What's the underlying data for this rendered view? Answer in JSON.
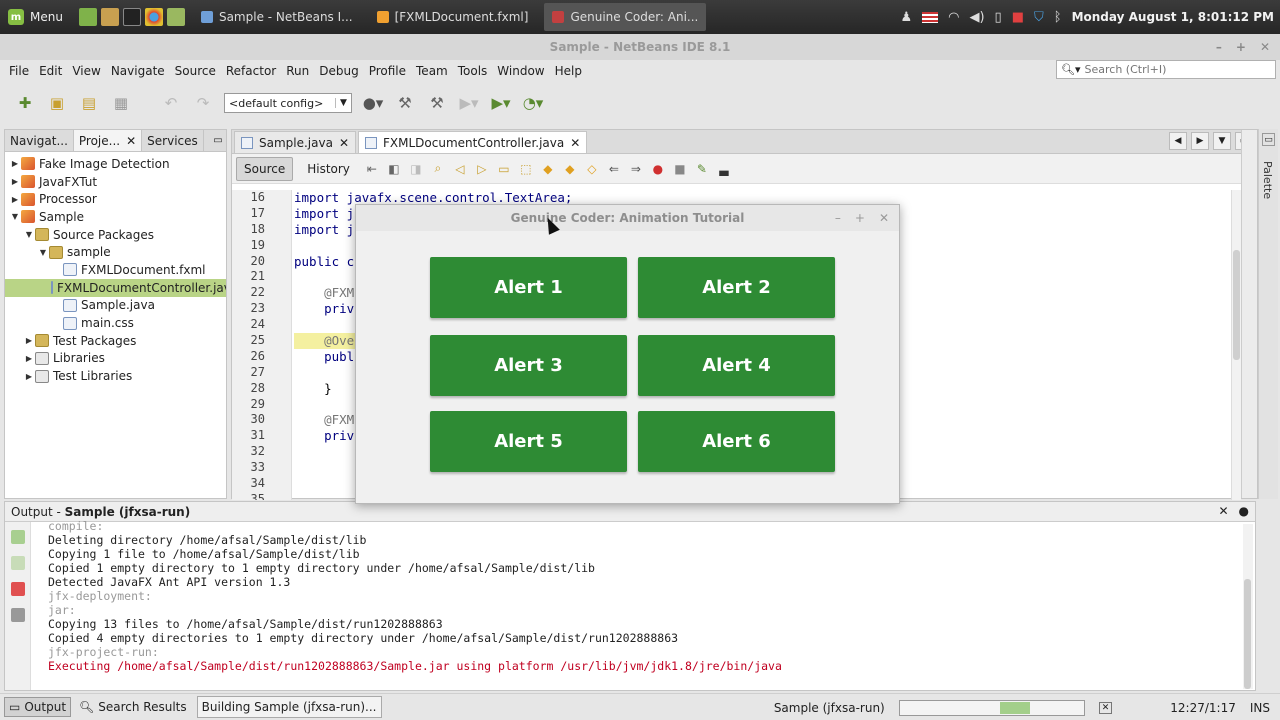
{
  "panel": {
    "menu_label": "Menu",
    "tasks": [
      {
        "label": "Sample - NetBeans I...",
        "color": "#6f9fd8"
      },
      {
        "label": "[FXMLDocument.fxml]",
        "color": "#f0a030"
      },
      {
        "label": "Genuine Coder: Ani...",
        "color": "#c24040"
      }
    ],
    "clock": "Monday August  1,  8:01:12 PM"
  },
  "ide": {
    "title": "Sample - NetBeans IDE 8.1",
    "menus": [
      "File",
      "Edit",
      "View",
      "Navigate",
      "Source",
      "Refactor",
      "Run",
      "Debug",
      "Profile",
      "Team",
      "Tools",
      "Window",
      "Help"
    ],
    "search_placeholder": "Search (Ctrl+I)",
    "config_value": "<default config>"
  },
  "left_panel": {
    "tabs": [
      "Navigat...",
      "Proje...",
      "Services"
    ],
    "tree": [
      {
        "label": "Fake Image Detection",
        "depth": 0,
        "arrow": "▶",
        "icon": "proj"
      },
      {
        "label": "JavaFXTut",
        "depth": 0,
        "arrow": "▶",
        "icon": "proj"
      },
      {
        "label": "Processor",
        "depth": 0,
        "arrow": "▶",
        "icon": "proj"
      },
      {
        "label": "Sample",
        "depth": 0,
        "arrow": "▼",
        "icon": "proj"
      },
      {
        "label": "Source Packages",
        "depth": 1,
        "arrow": "▼",
        "icon": "pkg"
      },
      {
        "label": "sample",
        "depth": 2,
        "arrow": "▼",
        "icon": "pkg"
      },
      {
        "label": "FXMLDocument.fxml",
        "depth": 3,
        "arrow": "",
        "icon": "file"
      },
      {
        "label": "FXMLDocumentController.java",
        "depth": 3,
        "arrow": "",
        "icon": "file",
        "selected": true
      },
      {
        "label": "Sample.java",
        "depth": 3,
        "arrow": "",
        "icon": "file"
      },
      {
        "label": "main.css",
        "depth": 3,
        "arrow": "",
        "icon": "file"
      },
      {
        "label": "Test Packages",
        "depth": 1,
        "arrow": "▶",
        "icon": "pkg"
      },
      {
        "label": "Libraries",
        "depth": 1,
        "arrow": "▶",
        "icon": "lib"
      },
      {
        "label": "Test Libraries",
        "depth": 1,
        "arrow": "▶",
        "icon": "lib"
      }
    ]
  },
  "editor": {
    "tabs": [
      {
        "label": "Sample.java",
        "active": false
      },
      {
        "label": "FXMLDocumentController.java",
        "active": true
      }
    ],
    "source_label": "Source",
    "history_label": "History",
    "line_numbers": [
      "16",
      "17",
      "18",
      "19",
      "20",
      "21",
      "22",
      "23",
      "24",
      "25",
      "26",
      "27",
      "28",
      "29",
      "30",
      "31",
      "32",
      "33",
      "34",
      "35"
    ],
    "lines": [
      "import javafx.scene.control.TextArea;",
      "import j",
      "import j",
      "",
      "public c",
      "",
      "    @FXM",
      "    priv",
      "",
      "    @Ove",
      "    publ",
      "",
      "    }",
      "",
      "    @FXM",
      "    priv",
      "",
      "",
      "",
      ""
    ]
  },
  "palette_label": "Palette",
  "output": {
    "title_prefix": "Output - ",
    "title_bold": "Sample (jfxsa-run)",
    "lines": [
      {
        "text": "compile:",
        "style": "dim"
      },
      {
        "text": "Deleting directory /home/afsal/Sample/dist/lib",
        "style": ""
      },
      {
        "text": "Copying 1 file to /home/afsal/Sample/dist/lib",
        "style": ""
      },
      {
        "text": "Copied 1 empty directory to 1 empty directory under /home/afsal/Sample/dist/lib",
        "style": ""
      },
      {
        "text": "Detected JavaFX Ant API version 1.3",
        "style": ""
      },
      {
        "text": "jfx-deployment:",
        "style": "dim"
      },
      {
        "text": "jar:",
        "style": "dim"
      },
      {
        "text": "Copying 13 files to /home/afsal/Sample/dist/run1202888863",
        "style": ""
      },
      {
        "text": "Copied 4 empty directories to 1 empty directory under /home/afsal/Sample/dist/run1202888863",
        "style": ""
      },
      {
        "text": "jfx-project-run:",
        "style": "dim"
      },
      {
        "text": "Executing /home/afsal/Sample/dist/run1202888863/Sample.jar using platform /usr/lib/jvm/jdk1.8/jre/bin/java",
        "style": "red"
      }
    ]
  },
  "statusbar": {
    "output_label": "Output",
    "search_results_label": "Search Results",
    "task_label": "Building Sample (jfxsa-run)...",
    "run_label": "Sample (jfxsa-run)",
    "position": "12:27/1:17",
    "mode": "INS"
  },
  "popup": {
    "title": "Genuine Coder: Animation Tutorial",
    "buttons": [
      "Alert 1",
      "Alert 2",
      "Alert 3",
      "Alert 4",
      "Alert 5",
      "Alert 6"
    ],
    "button_color": "#2e8b34"
  }
}
